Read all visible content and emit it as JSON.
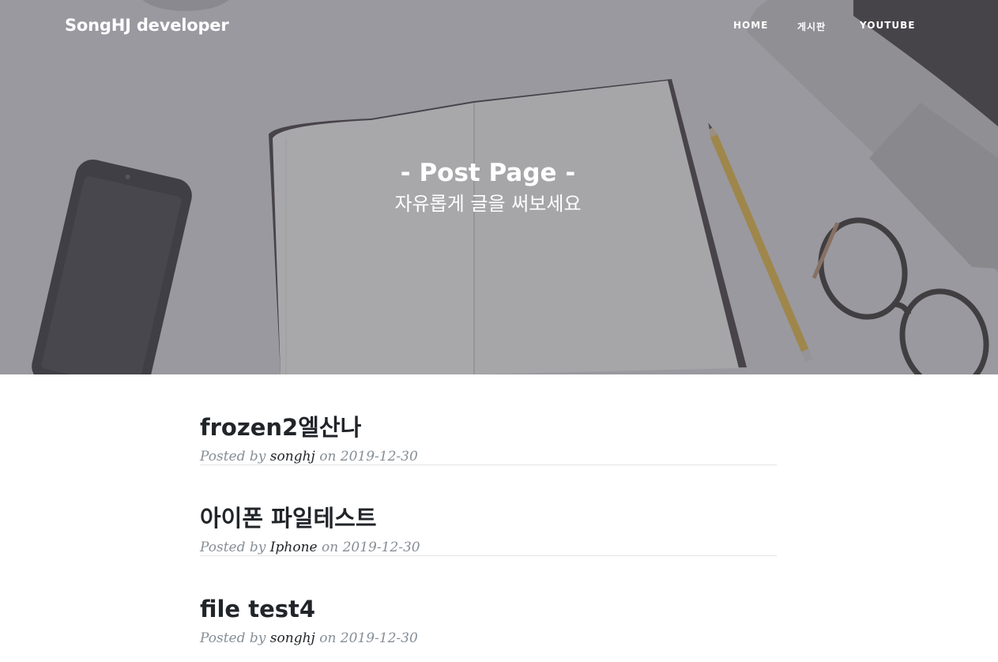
{
  "nav": {
    "brand": "SongHJ developer",
    "items": [
      {
        "label": "HOME"
      },
      {
        "label": "게시판"
      },
      {
        "label": "YOUTUBE"
      }
    ]
  },
  "hero": {
    "title": "- Post Page -",
    "subtitle": "자유롭게 글을 써보세요"
  },
  "posts": [
    {
      "title": "frozen2엘산나",
      "posted_by_label": "Posted by",
      "author": "songhj",
      "on_label": "on",
      "date": "2019-12-30"
    },
    {
      "title": "아이폰 파일테스트",
      "posted_by_label": "Posted by",
      "author": "Iphone",
      "on_label": "on",
      "date": "2019-12-30"
    },
    {
      "title": "file test4",
      "posted_by_label": "Posted by",
      "author": "songhj",
      "on_label": "on",
      "date": "2019-12-30"
    }
  ],
  "colors": {
    "title_text": "#212529",
    "meta_text": "#868e96",
    "divider": "#e4e4e4",
    "hero_overlay": "#55555f"
  }
}
